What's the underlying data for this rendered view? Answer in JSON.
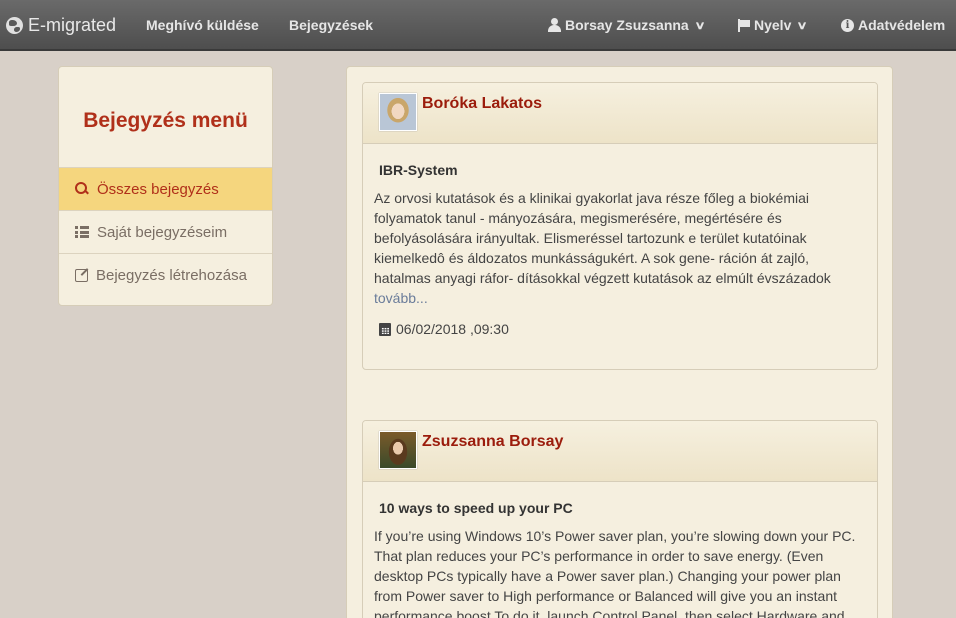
{
  "navbar": {
    "brand": "E-migrated",
    "send_invite": "Meghívó küldése",
    "posts": "Bejegyzések",
    "user": "Borsay Zsuzsanna",
    "language": "Nyelv",
    "privacy": "Adatvédelem"
  },
  "sidebar": {
    "title": "Bejegyzés menü",
    "items": [
      {
        "label": "Összes bejegyzés",
        "icon": "search-icon",
        "active": true
      },
      {
        "label": "Saját bejegyzéseim",
        "icon": "list-icon",
        "active": false
      },
      {
        "label": "Bejegyzés létrehozása",
        "icon": "edit-icon",
        "active": false
      }
    ]
  },
  "posts": [
    {
      "author": "Boróka Lakatos",
      "title": "IBR-System",
      "body_lines": [
        "Az orvosi kutatások és a klinikai gyakorlat java része főleg a biokémiai",
        "folyamatok tanul - mányozására, megismerésére, megértésére és",
        "befolyásolására irányultak. Elismeréssel tartozunk e terület kutatóinak",
        "kiemelkedô és áldozatos munkásságukért. A sok gene- ráción át zajló,",
        "hatalmas anyagi ráfor- dításokkal végzett kutatások az elmúlt évszázadok"
      ],
      "more": "tovább...",
      "date": "06/02/2018 ,09:30"
    },
    {
      "author": "Zsuzsanna Borsay",
      "title": "10 ways to speed up your PC",
      "body_lines": [
        "If you’re using Windows 10’s Power saver plan, you’re slowing down your PC.",
        "That plan reduces your PC’s performance in order to save energy. (Even",
        "desktop PCs typically have a Power saver plan.) Changing your power plan",
        "from Power saver to High performance or Balanced will give you an instant",
        "performance boost To do it, launch Control Panel, then select Hardware and"
      ]
    }
  ],
  "colors": {
    "accent": "#b0301a",
    "active_bg": "#f5d67e",
    "panel_bg": "#f5efdf",
    "page_bg": "#d8d0c8"
  }
}
